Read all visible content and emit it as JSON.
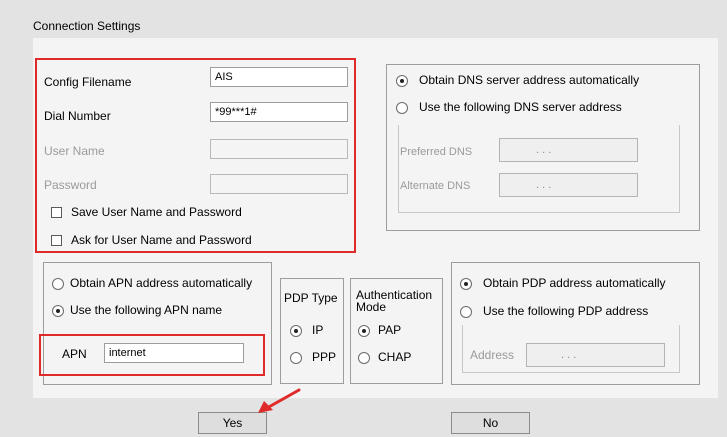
{
  "window": {
    "title": "Connection Settings"
  },
  "profile": {
    "config_filename_label": "Config Filename",
    "config_filename_value": "AIS",
    "dial_number_label": "Dial Number",
    "dial_number_value": "*99***1#",
    "username_label": "User Name",
    "username_value": "",
    "password_label": "Password",
    "password_value": "",
    "save_credentials_label": "Save User Name and Password",
    "ask_credentials_label": "Ask for User Name and Password"
  },
  "dns": {
    "auto_label": "Obtain DNS server address automatically",
    "manual_label": "Use the following DNS server address",
    "selected": "auto",
    "preferred_label": "Preferred DNS",
    "alternate_label": "Alternate DNS",
    "ip_separators": ".   .   ."
  },
  "apn": {
    "auto_label": "Obtain APN address automatically",
    "manual_label": "Use the following APN name",
    "selected": "manual",
    "name_label": "APN",
    "name_value": "internet"
  },
  "pdp_type": {
    "title": "PDP Type",
    "ip_label": "IP",
    "ppp_label": "PPP",
    "selected": "IP"
  },
  "auth": {
    "title_line1": "Authentication",
    "title_line2": "Mode",
    "pap_label": "PAP",
    "chap_label": "CHAP",
    "selected": "PAP"
  },
  "pdp": {
    "auto_label": "Obtain PDP address automatically",
    "manual_label": "Use the following PDP address",
    "selected": "auto",
    "address_label": "Address"
  },
  "buttons": {
    "yes_label": "Yes",
    "no_label": "No"
  },
  "colors": {
    "highlight": "#e02a2a",
    "panel": "#f4f4f4",
    "background": "#e3e3e3"
  }
}
